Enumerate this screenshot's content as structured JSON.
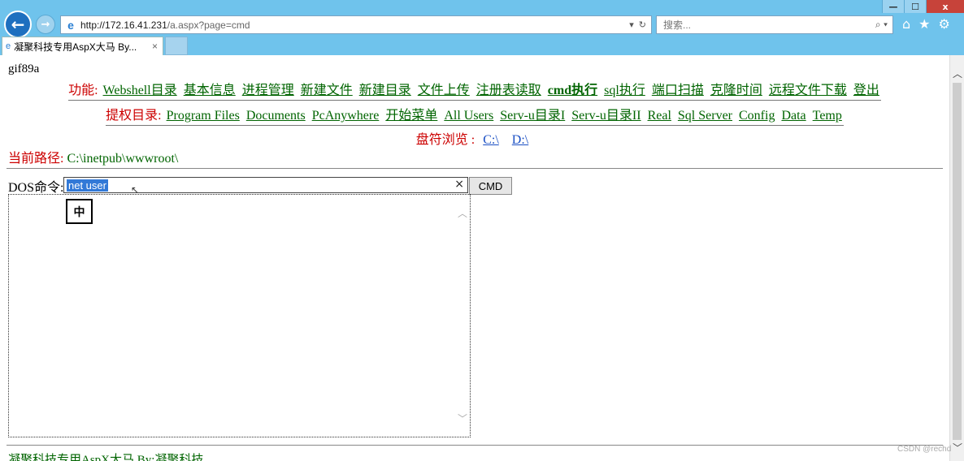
{
  "browser": {
    "url_host": "http://172.16.41.231",
    "url_path": "/a.aspx?page=cmd",
    "search_placeholder": "搜索...",
    "tab_title": "凝聚科技专用AspX大马 By...",
    "tab_close": "×",
    "win_minimize": "—",
    "win_maximize": "☐",
    "win_close": "x"
  },
  "page": {
    "gif_header": "gif89a",
    "func_label": "功能:",
    "func_links": [
      "Webshell目录",
      "基本信息",
      "进程管理",
      "新建文件",
      "新建目录",
      "文件上传",
      "注册表读取",
      "cmd执行",
      "sql执行",
      "端口扫描",
      "克隆时间",
      "远程文件下载",
      "登出"
    ],
    "priv_label": "提权目录:",
    "priv_links": [
      "Program Files",
      "Documents",
      "PcAnywhere",
      "开始菜单",
      "All Users",
      "Serv-u目录I",
      "Serv-u目录II",
      "Real",
      "Sql Server",
      "Config",
      "Data",
      "Temp"
    ],
    "drive_label": "盘符浏览 :",
    "drive_links": [
      "C:\\",
      "D:\\"
    ],
    "current_path_label": "当前路径:",
    "current_path": "C:\\inetpub\\wwwroot\\",
    "dos_label": "DOS命令:",
    "dos_value": "net user",
    "clear_glyph": "×",
    "cmd_button": "CMD",
    "ime_indicator": "中",
    "footer": "凝聚科技专用AspX大马 By:凝聚科技"
  },
  "watermark": "CSDN @rechd",
  "icons": {
    "back": "back-arrow-icon",
    "forward": "forward-arrow-icon",
    "ie": "ie-logo-icon",
    "search": "magnifier-icon",
    "home": "home-icon",
    "favorites": "star-icon",
    "settings": "gear-icon"
  }
}
